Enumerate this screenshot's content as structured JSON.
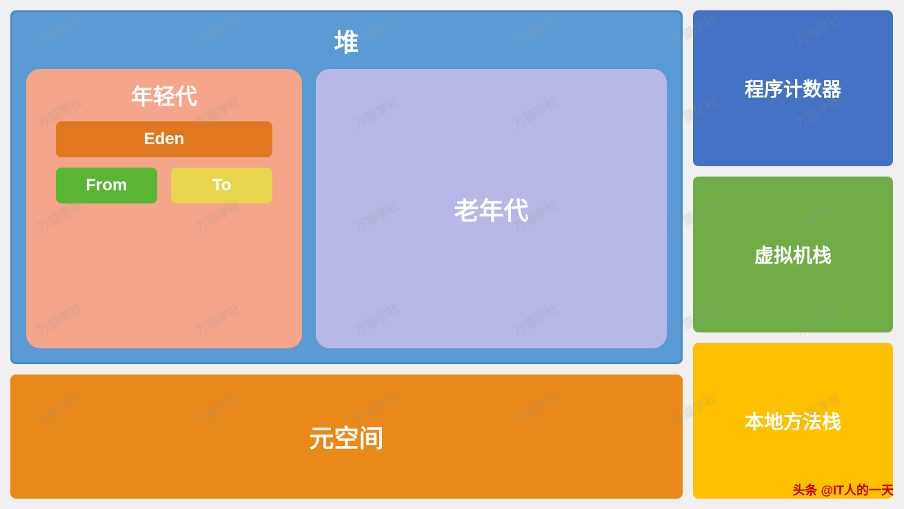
{
  "heap": {
    "title": "堆",
    "young_gen": {
      "title": "年轻代",
      "eden": "Eden",
      "from": "From",
      "to": "To"
    },
    "old_gen": {
      "title": "老年代"
    }
  },
  "metaspace": {
    "title": "元空间"
  },
  "right_panel": {
    "program_counter": "程序计数器",
    "vm_stack": "虚拟机栈",
    "native_stack": "本地方法栈"
  },
  "footer": "头条 @IT人的一天",
  "colors": {
    "heap_bg": "#5b9bd5",
    "young_gen_bg": "#f4a58a",
    "eden_bg": "#e07820",
    "from_bg": "#5ab534",
    "to_bg": "#e8d44d",
    "old_gen_bg": "#b8b8e8",
    "metaspace_bg": "#e8891a",
    "program_counter_bg": "#4472c4",
    "vm_stack_bg": "#70ad47",
    "native_stack_bg": "#ffc000"
  }
}
